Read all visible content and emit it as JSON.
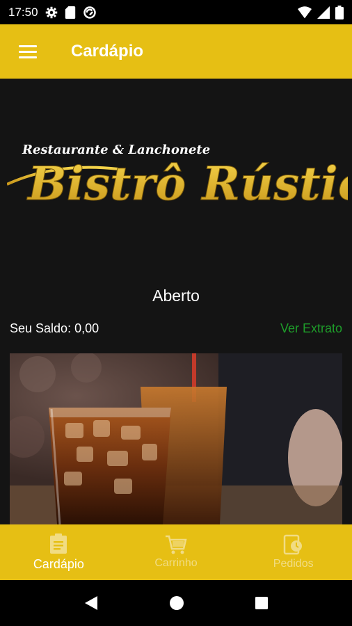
{
  "status_bar": {
    "time": "17:50",
    "left_icons": [
      "gear-icon",
      "sd-card-icon",
      "sync-icon"
    ],
    "right_icons": [
      "wifi-icon",
      "signal-icon",
      "battery-icon"
    ]
  },
  "app_bar": {
    "title": "Cardápio",
    "menu_icon": "hamburger-menu-icon",
    "color": "#E6BF14"
  },
  "logo": {
    "line1": "Restaurante & Lanchonete",
    "line2": "Bistrô Rústico"
  },
  "store": {
    "status": "Aberto",
    "balance_label": "Seu Saldo: 0,00",
    "extract_link": "Ver Extrato"
  },
  "promo_image": {
    "description_icon": "soft-drinks-photo"
  },
  "bottom_nav": {
    "items": [
      {
        "label": "Cardápio",
        "icon": "menu-list-icon",
        "active": true
      },
      {
        "label": "Carrinho",
        "icon": "cart-icon",
        "active": false
      },
      {
        "label": "Pedidos",
        "icon": "orders-icon",
        "active": false
      }
    ]
  },
  "system_nav": {
    "icons": [
      "back-icon",
      "home-icon",
      "recents-icon"
    ]
  },
  "colors": {
    "accent": "#E6BF14",
    "background": "#141414",
    "link_green": "#1E9E2A"
  }
}
